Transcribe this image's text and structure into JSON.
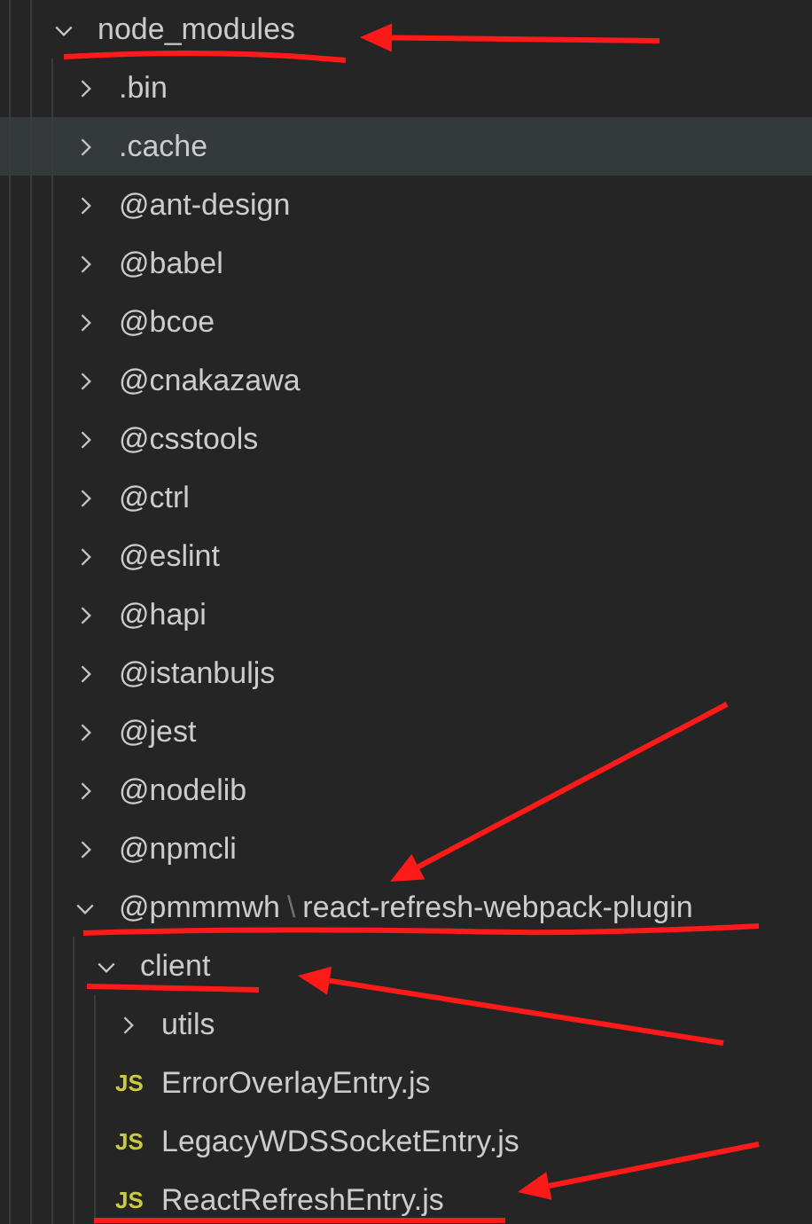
{
  "tree": [
    {
      "kind": "folder",
      "name": "node_modules",
      "expanded": true,
      "highlighted": false,
      "children": [
        {
          "kind": "folder",
          "name": ".bin",
          "expanded": false,
          "highlighted": false
        },
        {
          "kind": "folder",
          "name": ".cache",
          "expanded": false,
          "highlighted": true
        },
        {
          "kind": "folder",
          "name": "@ant-design",
          "expanded": false,
          "highlighted": false
        },
        {
          "kind": "folder",
          "name": "@babel",
          "expanded": false,
          "highlighted": false
        },
        {
          "kind": "folder",
          "name": "@bcoe",
          "expanded": false,
          "highlighted": false
        },
        {
          "kind": "folder",
          "name": "@cnakazawa",
          "expanded": false,
          "highlighted": false
        },
        {
          "kind": "folder",
          "name": "@csstools",
          "expanded": false,
          "highlighted": false
        },
        {
          "kind": "folder",
          "name": "@ctrl",
          "expanded": false,
          "highlighted": false
        },
        {
          "kind": "folder",
          "name": "@eslint",
          "expanded": false,
          "highlighted": false
        },
        {
          "kind": "folder",
          "name": "@hapi",
          "expanded": false,
          "highlighted": false
        },
        {
          "kind": "folder",
          "name": "@istanbuljs",
          "expanded": false,
          "highlighted": false
        },
        {
          "kind": "folder",
          "name": "@jest",
          "expanded": false,
          "highlighted": false
        },
        {
          "kind": "folder",
          "name": "@nodelib",
          "expanded": false,
          "highlighted": false
        },
        {
          "kind": "folder",
          "name": "@npmcli",
          "expanded": false,
          "highlighted": false
        },
        {
          "kind": "compact_folder",
          "path": [
            "@pmmmwh",
            "react-refresh-webpack-plugin"
          ],
          "separator": "\\",
          "expanded": true,
          "highlighted": false,
          "children": [
            {
              "kind": "folder",
              "name": "client",
              "expanded": true,
              "highlighted": false,
              "children": [
                {
                  "kind": "folder",
                  "name": "utils",
                  "expanded": false,
                  "highlighted": false
                },
                {
                  "kind": "file",
                  "name": "ErrorOverlayEntry.js",
                  "badge": "JS",
                  "highlighted": false
                },
                {
                  "kind": "file",
                  "name": "LegacyWDSSocketEntry.js",
                  "badge": "JS",
                  "highlighted": false
                },
                {
                  "kind": "file",
                  "name": "ReactRefreshEntry.js",
                  "badge": "JS",
                  "highlighted": false
                }
              ]
            }
          ]
        }
      ]
    }
  ]
}
